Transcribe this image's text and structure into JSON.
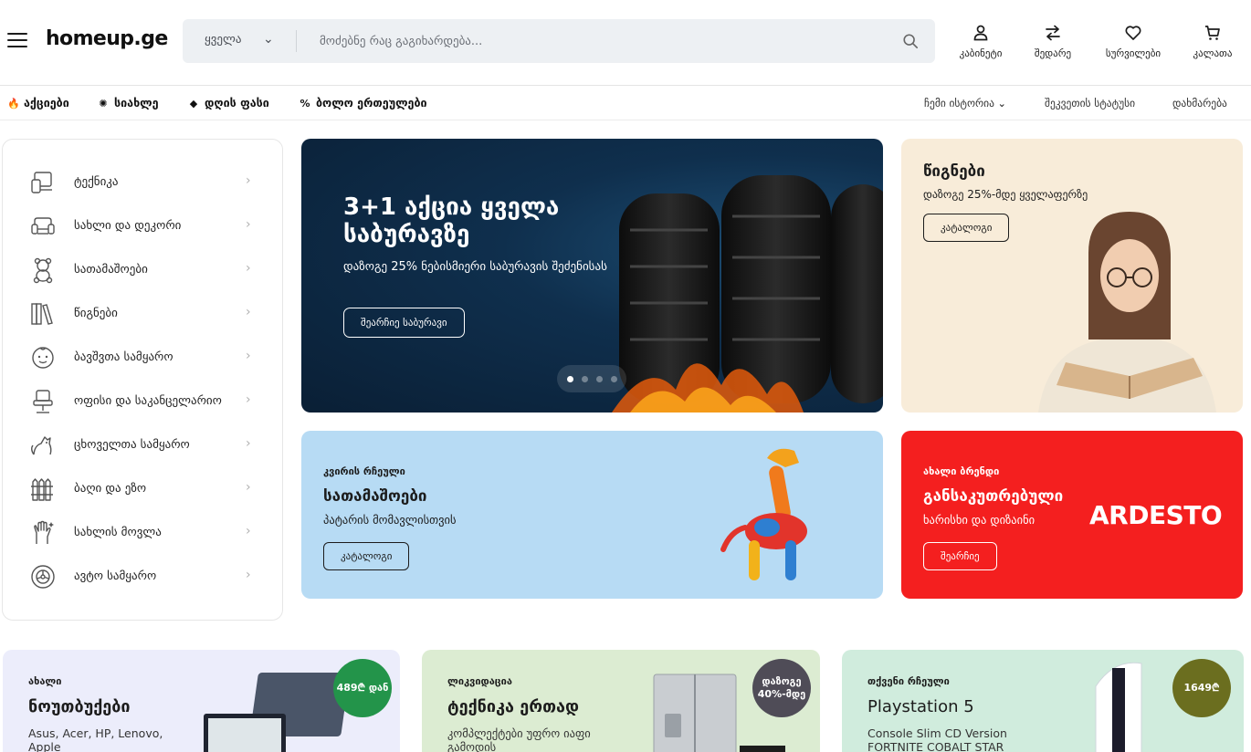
{
  "header": {
    "logo": "homeup.ge",
    "search": {
      "category": "ყველა",
      "placeholder": "მოძებნე რაც გაგიხარდება..."
    },
    "actions": [
      {
        "label": "კაბინეტი",
        "icon": "user-icon"
      },
      {
        "label": "შედარე",
        "icon": "compare-arrows-icon"
      },
      {
        "label": "სურვილები",
        "icon": "heart-icon"
      },
      {
        "label": "კალათა",
        "icon": "cart-icon"
      }
    ]
  },
  "nav": {
    "left": [
      {
        "label": "აქციები",
        "icon": "fire-icon"
      },
      {
        "label": "სიახლე",
        "icon": "sparkle-icon"
      },
      {
        "label": "დღის ფასი",
        "icon": "tag-icon"
      },
      {
        "label": "ბოლო ერთეულები",
        "icon": "percent-icon"
      }
    ],
    "right": [
      {
        "label": "ჩემი ისტორია",
        "icon": "chevron-down-icon"
      },
      {
        "label": "შეკვეთის სტატუსი"
      },
      {
        "label": "დახმარება"
      }
    ]
  },
  "sidebar": {
    "items": [
      {
        "label": "ტექნიკა",
        "icon": "devices-icon"
      },
      {
        "label": "სახლი და დეკორი",
        "icon": "sofa-icon"
      },
      {
        "label": "სათამაშოები",
        "icon": "teddy-bear-icon"
      },
      {
        "label": "წიგნები",
        "icon": "books-icon"
      },
      {
        "label": "ბავშვთა სამყარო",
        "icon": "baby-icon"
      },
      {
        "label": "ოფისი და საკანცელარიო",
        "icon": "office-chair-icon"
      },
      {
        "label": "ცხოველთა სამყარო",
        "icon": "pet-icon"
      },
      {
        "label": "ბაღი და ეზო",
        "icon": "fence-icon"
      },
      {
        "label": "სახლის მოვლა",
        "icon": "cleaning-glove-icon"
      },
      {
        "label": "ავტო სამყარო",
        "icon": "wheel-icon"
      }
    ]
  },
  "hero": {
    "title": "3+1 აქცია ყველა საბურავზე",
    "subtitle": "დაზოგე 25% ნებისმიერი საბურავის შეძენისას",
    "button": "შეარჩიე საბურავი",
    "slides": 4,
    "active_slide": 1
  },
  "books_banner": {
    "title": "წიგნები",
    "subtitle": "დაზოგე 25%-მდე ყველაფერზე",
    "button": "კატალოგი"
  },
  "toys_banner": {
    "kicker": "კვირის რჩეული",
    "title": "სათამაშოები",
    "subtitle": "პატარის მომავლისთვის",
    "button": "კატალოგი"
  },
  "ardesto_banner": {
    "kicker": "ახალი ბრენდი",
    "title": "განსაკუთრებული",
    "subtitle": "ხარისხი და დიზაინი",
    "button": "შეარჩიე",
    "brand": "ARDESTO"
  },
  "cards": [
    {
      "kicker": "ახალი",
      "title": "ნოუთბუქები",
      "desc": "Asus, Acer, HP, Lenovo, Apple",
      "badge": "489₾ დან",
      "badge_color": "#23944a"
    },
    {
      "kicker": "ლიკვიდაცია",
      "title": "ტექნიკა ერთად",
      "desc": "კომპლექტები უფრო იაფი გამოდის",
      "badge": "დაზოგე 40%-მდე",
      "badge_color": "#4f4c57"
    },
    {
      "kicker": "თქვენი რჩეული",
      "title": "Playstation 5",
      "desc": "Console Slim CD Version FORTNITE COBALT STAR",
      "badge": "1649₾",
      "badge_color": "#6b6e1f"
    }
  ],
  "colors": {
    "brand_red": "#f41f1f",
    "hero_bg": "#0f2f4d",
    "books_bg": "#f8ecd9",
    "toys_bg": "#b7dbf4"
  }
}
